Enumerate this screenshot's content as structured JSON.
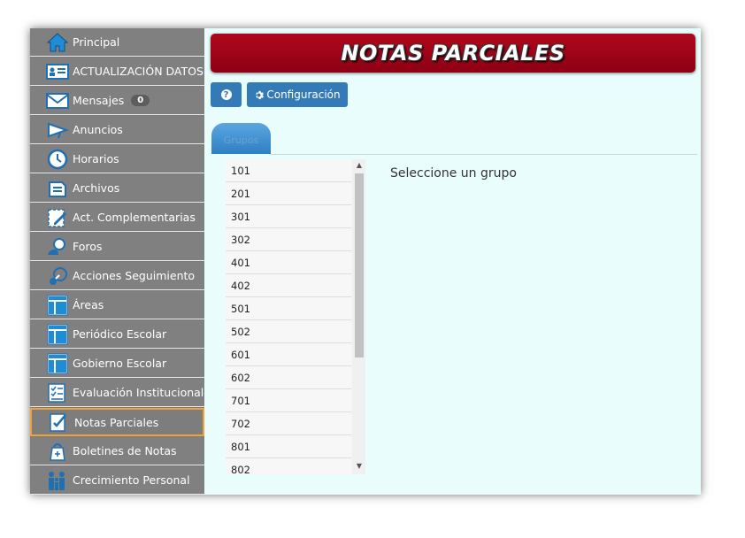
{
  "sidebar": {
    "items": [
      {
        "label": "Principal",
        "icon": "home-icon"
      },
      {
        "label": "ACTUALIZACIÓN DATOS",
        "icon": "id-card-icon"
      },
      {
        "label": "Mensajes",
        "icon": "envelope-icon",
        "badge": "0"
      },
      {
        "label": "Anuncios",
        "icon": "megaphone-icon"
      },
      {
        "label": "Horarios",
        "icon": "clock-icon"
      },
      {
        "label": "Archivos",
        "icon": "files-icon"
      },
      {
        "label": "Act. Complementarias",
        "icon": "edit-note-icon"
      },
      {
        "label": "Foros",
        "icon": "forum-user-icon"
      },
      {
        "label": "Acciones Seguimiento",
        "icon": "tracking-icon"
      },
      {
        "label": "Áreas",
        "icon": "layout-icon"
      },
      {
        "label": "Periódico Escolar",
        "icon": "layout-icon"
      },
      {
        "label": "Gobierno Escolar",
        "icon": "layout-icon"
      },
      {
        "label": "Evaluación Institucional",
        "icon": "checklist-icon"
      },
      {
        "label": "Notas Parciales",
        "icon": "grades-icon",
        "active": true
      },
      {
        "label": "Boletines de Notas",
        "icon": "bag-icon"
      },
      {
        "label": "Crecimiento Personal",
        "icon": "family-icon"
      }
    ]
  },
  "header": {
    "title": "NOTAS PARCIALES"
  },
  "toolbar": {
    "help_icon": "question-circle-icon",
    "config_icon": "gear-icon",
    "config_label": "Configuración"
  },
  "tabs": [
    {
      "label": "Grupos",
      "active": true
    }
  ],
  "groups": [
    "101",
    "201",
    "301",
    "302",
    "401",
    "402",
    "501",
    "502",
    "601",
    "602",
    "701",
    "702",
    "801",
    "802"
  ],
  "main": {
    "prompt": "Seleccione un grupo"
  },
  "colors": {
    "accent": "#337ab7",
    "title_bar": "#a3081a",
    "sidebar": "#808080",
    "active_border": "#f0a23a",
    "background": "#e9fdfd"
  }
}
